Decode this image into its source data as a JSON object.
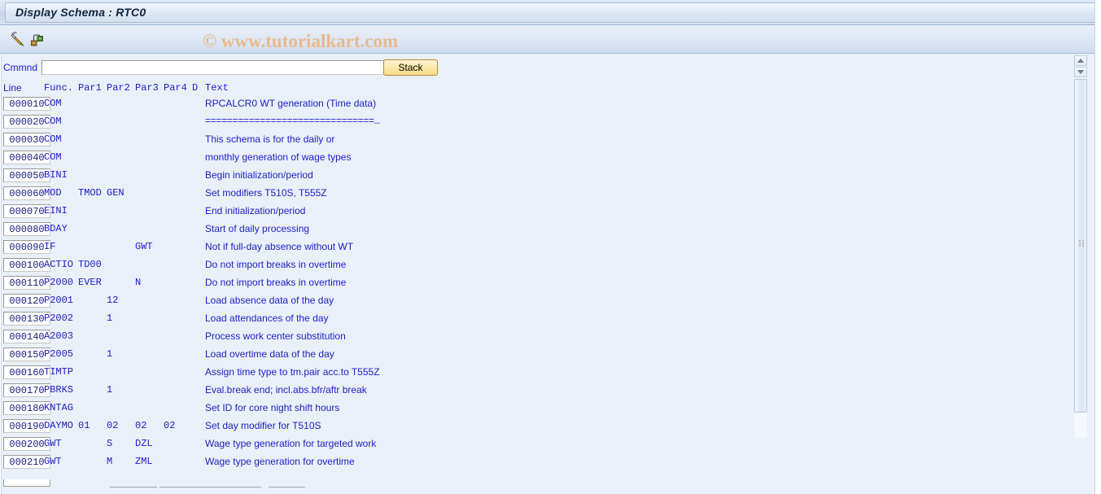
{
  "window": {
    "title": "Display Schema : RTC0"
  },
  "watermark": {
    "text": "© www.tutorialkart.com"
  },
  "toolbar": {
    "buttons": [
      {
        "name": "edit-pencil-icon",
        "tooltip": "Change"
      },
      {
        "name": "structure-hierarchy-icon",
        "tooltip": "Structure"
      }
    ]
  },
  "command": {
    "label": "Cmmnd",
    "value": "",
    "placeholder": "",
    "stack_label": "Stack"
  },
  "columns": {
    "line": "Line",
    "func": "Func.",
    "par1": "Par1",
    "par2": "Par2",
    "par3": "Par3",
    "par4": "Par4",
    "d": "D",
    "text": "Text"
  },
  "colors": {
    "text_blue": "#2020c8",
    "title_text": "#12263e",
    "watermark": "#e8b98e",
    "background": "#eaf0f8",
    "stack_button": "#fbe9a8"
  },
  "rows": [
    {
      "line": "000010",
      "func": "COM",
      "par1": "",
      "par2": "",
      "par3": "",
      "par4": "",
      "d": "",
      "text": "RPCALCR0 WT generation (Time data)"
    },
    {
      "line": "000020",
      "func": "COM",
      "par1": "",
      "par2": "",
      "par3": "",
      "par4": "",
      "d": "",
      "text": "===============================…"
    },
    {
      "line": "000030",
      "func": "COM",
      "par1": "",
      "par2": "",
      "par3": "",
      "par4": "",
      "d": "",
      "text": "This schema is for the daily or"
    },
    {
      "line": "000040",
      "func": "COM",
      "par1": "",
      "par2": "",
      "par3": "",
      "par4": "",
      "d": "",
      "text": "monthly generation of wage types"
    },
    {
      "line": "000050",
      "func": "BINI",
      "par1": "",
      "par2": "",
      "par3": "",
      "par4": "",
      "d": "",
      "text": "Begin initialization/period"
    },
    {
      "line": "000060",
      "func": "MOD",
      "par1": "TMOD",
      "par2": "GEN",
      "par3": "",
      "par4": "",
      "d": "",
      "text": "Set modifiers T510S, T555Z"
    },
    {
      "line": "000070",
      "func": "EINI",
      "par1": "",
      "par2": "",
      "par3": "",
      "par4": "",
      "d": "",
      "text": "End initialization/period"
    },
    {
      "line": "000080",
      "func": "BDAY",
      "par1": "",
      "par2": "",
      "par3": "",
      "par4": "",
      "d": "",
      "text": "Start of daily processing"
    },
    {
      "line": "000090",
      "func": "IF",
      "par1": "",
      "par2": "",
      "par3": "GWT",
      "par4": "",
      "d": "",
      "text": "Not if full-day absence without WT"
    },
    {
      "line": "000100",
      "func": "ACTIO",
      "par1": "TD00",
      "par2": "",
      "par3": "",
      "par4": "",
      "d": "",
      "text": "Do not import breaks in overtime"
    },
    {
      "line": "000110",
      "func": "P2000",
      "par1": "EVER",
      "par2": "",
      "par3": "N",
      "par4": "",
      "d": "",
      "text": "Do not import breaks in overtime"
    },
    {
      "line": "000120",
      "func": "P2001",
      "par1": "",
      "par2": "12",
      "par3": "",
      "par4": "",
      "d": "",
      "text": "Load absence data of the day"
    },
    {
      "line": "000130",
      "func": "P2002",
      "par1": "",
      "par2": "1",
      "par3": "",
      "par4": "",
      "d": "",
      "text": "Load attendances of the day"
    },
    {
      "line": "000140",
      "func": "A2003",
      "par1": "",
      "par2": "",
      "par3": "",
      "par4": "",
      "d": "",
      "text": "Process work center substitution"
    },
    {
      "line": "000150",
      "func": "P2005",
      "par1": "",
      "par2": "1",
      "par3": "",
      "par4": "",
      "d": "",
      "text": "Load overtime data of the day"
    },
    {
      "line": "000160",
      "func": "TIMTP",
      "par1": "",
      "par2": "",
      "par3": "",
      "par4": "",
      "d": "",
      "text": "Assign time type to tm.pair acc.to T555Z"
    },
    {
      "line": "000170",
      "func": "PBRKS",
      "par1": "",
      "par2": "1",
      "par3": "",
      "par4": "",
      "d": "",
      "text": "Eval.break end; incl.abs.bfr/aftr break"
    },
    {
      "line": "000180",
      "func": "KNTAG",
      "par1": "",
      "par2": "",
      "par3": "",
      "par4": "",
      "d": "",
      "text": "Set ID for core night shift hours"
    },
    {
      "line": "000190",
      "func": "DAYMO",
      "par1": "01",
      "par2": "02",
      "par3": "02",
      "par4": "02",
      "d": "",
      "text": "Set day modifier for T510S"
    },
    {
      "line": "000200",
      "func": "GWT",
      "par1": "",
      "par2": "S",
      "par3": "DZL",
      "par4": "",
      "d": "",
      "text": "Wage type generation for targeted work"
    },
    {
      "line": "000210",
      "func": "GWT",
      "par1": "",
      "par2": "M",
      "par3": "ZML",
      "par4": "",
      "d": "",
      "text": "Wage type generation for overtime"
    }
  ]
}
